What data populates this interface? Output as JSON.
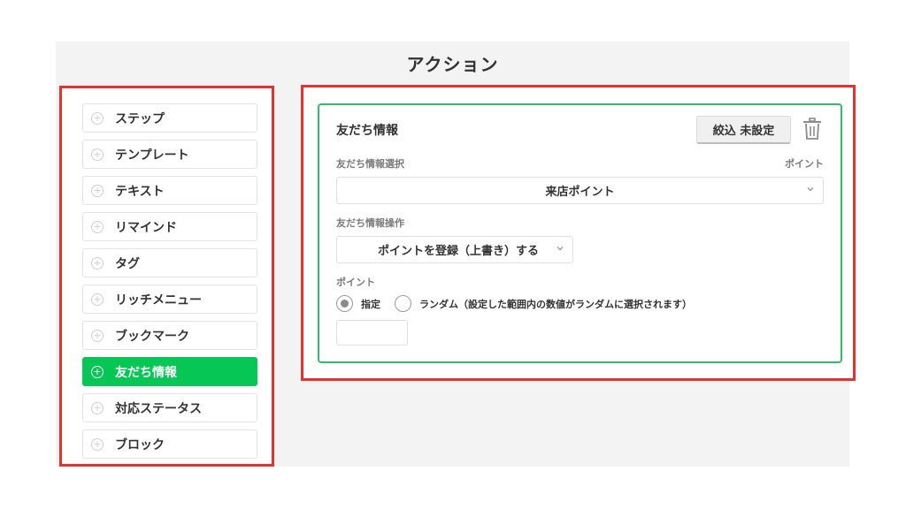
{
  "header": {
    "title": "アクション"
  },
  "sidebar": {
    "items": [
      {
        "label": "ステップ",
        "active": false
      },
      {
        "label": "テンプレート",
        "active": false
      },
      {
        "label": "テキスト",
        "active": false
      },
      {
        "label": "リマインド",
        "active": false
      },
      {
        "label": "タグ",
        "active": false
      },
      {
        "label": "リッチメニュー",
        "active": false
      },
      {
        "label": "ブックマーク",
        "active": false
      },
      {
        "label": "友だち情報",
        "active": true
      },
      {
        "label": "対応ステータス",
        "active": false
      },
      {
        "label": "ブロック",
        "active": false
      }
    ]
  },
  "card": {
    "title": "友だち情報",
    "filter_button": "絞込 未設定",
    "delete_icon": "trash-icon",
    "info_select": {
      "label": "友だち情報選択",
      "right_label": "ポイント",
      "value": "来店ポイント"
    },
    "operation": {
      "label": "友だち情報操作",
      "value": "ポイントを登録（上書き）する"
    },
    "point": {
      "label": "ポイント",
      "option_specified": "指定",
      "option_random": "ランダム（設定した範囲内の数値がランダムに選択されます）",
      "selected": "指定",
      "input_value": ""
    }
  },
  "colors": {
    "accent_green": "#06c755",
    "highlight_red": "#e8312f",
    "card_border": "#2cc168"
  }
}
